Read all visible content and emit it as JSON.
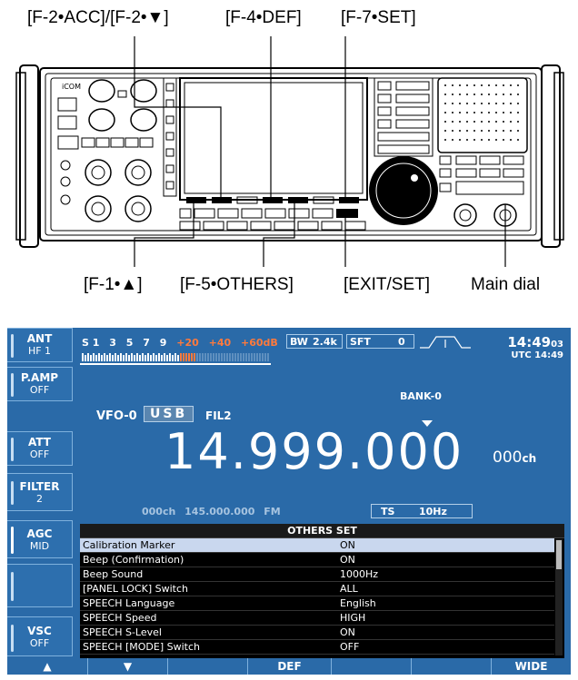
{
  "callouts": {
    "f2_acc": "[F-2•ACC]/[F-2•▼]",
    "f4_def": "[F-4•DEF]",
    "f7_set": "[F-7•SET]",
    "f1_up": "[F-1•▲]",
    "f5_others": "[F-5•OTHERS]",
    "exit_set": "[EXIT/SET]",
    "main_dial": "Main dial"
  },
  "radio": {
    "brand": "iCOM"
  },
  "side_buttons": [
    {
      "label": "ANT",
      "value": "HF 1"
    },
    {
      "label": "P.AMP",
      "value": "OFF"
    },
    {
      "label": "ATT",
      "value": "OFF"
    },
    {
      "label": "FILTER",
      "value": "2"
    },
    {
      "label": "AGC",
      "value": "MID"
    },
    {
      "label": "",
      "value": ""
    },
    {
      "label": "VSC",
      "value": "OFF"
    }
  ],
  "smeter": {
    "scale": [
      "S 1",
      "3",
      "5",
      "7",
      "9"
    ],
    "over_scale": [
      "+20",
      "+40",
      "+60dB"
    ],
    "over_color": "#ff7a3c"
  },
  "bw": {
    "label": "BW",
    "value": "2.4k"
  },
  "sft": {
    "label": "SFT",
    "value": "0"
  },
  "clock": {
    "time": "14:49",
    "seconds": "03",
    "utc": "UTC 14:49"
  },
  "bank": "BANK-0",
  "vfo": "VFO-0",
  "mode": "USB",
  "filter": "FIL2",
  "frequency": "14.999.000",
  "channel": {
    "value": "000",
    "unit": "ch"
  },
  "sub_receiver": "000ch  145.000.000  FM",
  "tuning_step": {
    "label": "TS",
    "value": "10Hz"
  },
  "others_set": {
    "title": "OTHERS SET",
    "rows": [
      {
        "name": "Calibration Marker",
        "value": "ON",
        "selected": true
      },
      {
        "name": "Beep (Confirmation)",
        "value": "ON"
      },
      {
        "name": "Beep Sound",
        "value": "1000Hz"
      },
      {
        "name": "[PANEL LOCK] Switch",
        "value": "ALL"
      },
      {
        "name": "SPEECH Language",
        "value": "English"
      },
      {
        "name": "SPEECH Speed",
        "value": "HIGH"
      },
      {
        "name": "SPEECH S-Level",
        "value": "ON"
      },
      {
        "name": "SPEECH [MODE] Switch",
        "value": "OFF"
      }
    ]
  },
  "function_keys": [
    "▲",
    "▼",
    "",
    "DEF",
    "",
    "",
    "WIDE"
  ],
  "colors": {
    "screen_bg": "#2a6aa8",
    "selected_row": "#c9d7ee",
    "table_bg": "#000000"
  }
}
